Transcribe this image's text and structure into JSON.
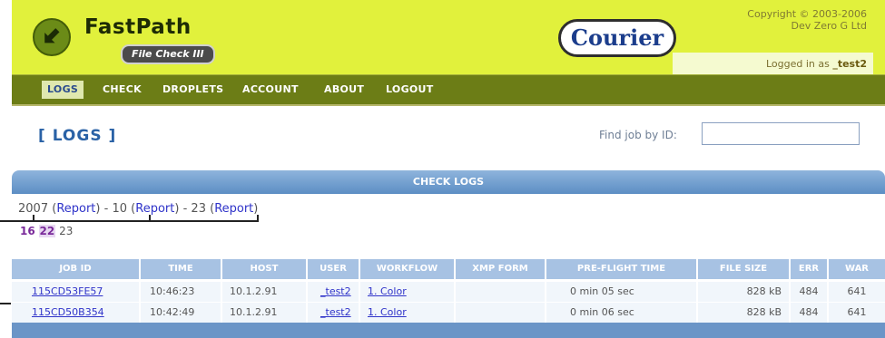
{
  "header": {
    "brand": "FastPath",
    "subbrand": "File Check III",
    "partner_logo": "Courier",
    "copyright_line1": "Copyright © 2003-2006",
    "copyright_line2": "Dev Zero G Ltd",
    "logged_in_prefix": "Logged in as",
    "logged_in_user": "_test2",
    "logo_icon": "green-arrow-logo-icon"
  },
  "nav": {
    "items": [
      "LOGS",
      "CHECK",
      "DROPLETS",
      "ACCOUNT",
      "ABOUT",
      "LOGOUT"
    ]
  },
  "page": {
    "title": "[ LOGS ]",
    "find_label": "Find job by ID:",
    "find_value": ""
  },
  "section": {
    "title": "CHECK LOGS"
  },
  "date_filter": {
    "year": "2007",
    "month": "10",
    "day": "23",
    "report_label": "Report",
    "separator": "-",
    "days": [
      "16",
      "22",
      "23"
    ]
  },
  "table": {
    "headers": [
      "JOB ID",
      "TIME",
      "HOST",
      "USER",
      "WORKFLOW",
      "XMP FORM",
      "PRE-FLIGHT TIME",
      "FILE SIZE",
      "ERR",
      "WAR"
    ],
    "rows": [
      [
        "115CD53FE57",
        "10:46:23",
        "10.1.2.91",
        "_test2",
        "1. Color",
        "",
        "0 min 05 sec",
        "828 kB",
        "484",
        "641"
      ],
      [
        "115CD50B354",
        "10:42:49",
        "10.1.2.91",
        "_test2",
        "1. Color",
        "",
        "0 min 06 sec",
        "828 kB",
        "484",
        "641"
      ]
    ]
  },
  "colors": {
    "header_bg": "#e1f13c",
    "nav_bg": "#6c7d16",
    "section_bar": "#5c8ec4",
    "link": "#2f33c9"
  }
}
